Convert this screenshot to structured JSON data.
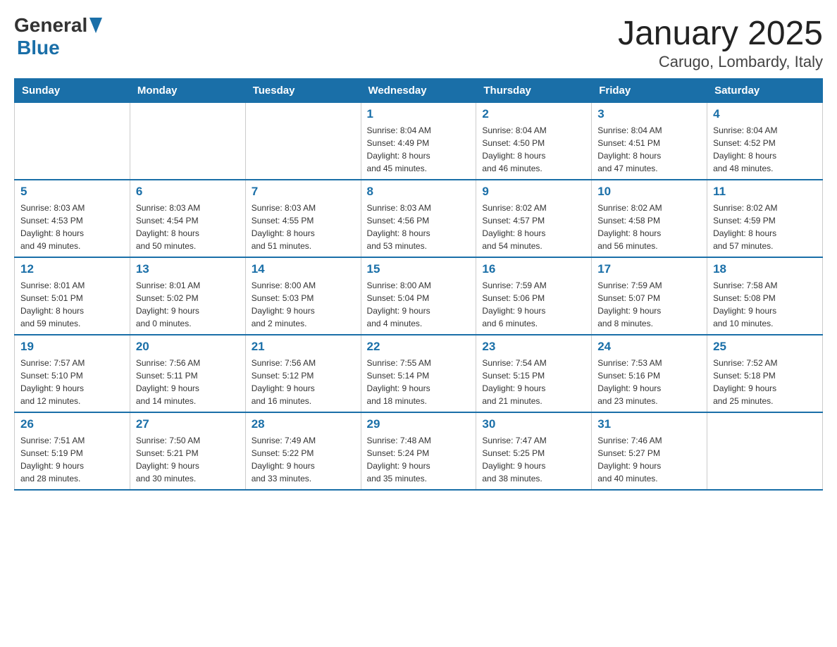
{
  "header": {
    "logo": {
      "general": "General",
      "blue": "Blue",
      "tagline": "GeneralBlue"
    },
    "title": "January 2025",
    "subtitle": "Carugo, Lombardy, Italy"
  },
  "days_of_week": [
    "Sunday",
    "Monday",
    "Tuesday",
    "Wednesday",
    "Thursday",
    "Friday",
    "Saturday"
  ],
  "weeks": [
    [
      {
        "day": "",
        "info": ""
      },
      {
        "day": "",
        "info": ""
      },
      {
        "day": "",
        "info": ""
      },
      {
        "day": "1",
        "info": "Sunrise: 8:04 AM\nSunset: 4:49 PM\nDaylight: 8 hours\nand 45 minutes."
      },
      {
        "day": "2",
        "info": "Sunrise: 8:04 AM\nSunset: 4:50 PM\nDaylight: 8 hours\nand 46 minutes."
      },
      {
        "day": "3",
        "info": "Sunrise: 8:04 AM\nSunset: 4:51 PM\nDaylight: 8 hours\nand 47 minutes."
      },
      {
        "day": "4",
        "info": "Sunrise: 8:04 AM\nSunset: 4:52 PM\nDaylight: 8 hours\nand 48 minutes."
      }
    ],
    [
      {
        "day": "5",
        "info": "Sunrise: 8:03 AM\nSunset: 4:53 PM\nDaylight: 8 hours\nand 49 minutes."
      },
      {
        "day": "6",
        "info": "Sunrise: 8:03 AM\nSunset: 4:54 PM\nDaylight: 8 hours\nand 50 minutes."
      },
      {
        "day": "7",
        "info": "Sunrise: 8:03 AM\nSunset: 4:55 PM\nDaylight: 8 hours\nand 51 minutes."
      },
      {
        "day": "8",
        "info": "Sunrise: 8:03 AM\nSunset: 4:56 PM\nDaylight: 8 hours\nand 53 minutes."
      },
      {
        "day": "9",
        "info": "Sunrise: 8:02 AM\nSunset: 4:57 PM\nDaylight: 8 hours\nand 54 minutes."
      },
      {
        "day": "10",
        "info": "Sunrise: 8:02 AM\nSunset: 4:58 PM\nDaylight: 8 hours\nand 56 minutes."
      },
      {
        "day": "11",
        "info": "Sunrise: 8:02 AM\nSunset: 4:59 PM\nDaylight: 8 hours\nand 57 minutes."
      }
    ],
    [
      {
        "day": "12",
        "info": "Sunrise: 8:01 AM\nSunset: 5:01 PM\nDaylight: 8 hours\nand 59 minutes."
      },
      {
        "day": "13",
        "info": "Sunrise: 8:01 AM\nSunset: 5:02 PM\nDaylight: 9 hours\nand 0 minutes."
      },
      {
        "day": "14",
        "info": "Sunrise: 8:00 AM\nSunset: 5:03 PM\nDaylight: 9 hours\nand 2 minutes."
      },
      {
        "day": "15",
        "info": "Sunrise: 8:00 AM\nSunset: 5:04 PM\nDaylight: 9 hours\nand 4 minutes."
      },
      {
        "day": "16",
        "info": "Sunrise: 7:59 AM\nSunset: 5:06 PM\nDaylight: 9 hours\nand 6 minutes."
      },
      {
        "day": "17",
        "info": "Sunrise: 7:59 AM\nSunset: 5:07 PM\nDaylight: 9 hours\nand 8 minutes."
      },
      {
        "day": "18",
        "info": "Sunrise: 7:58 AM\nSunset: 5:08 PM\nDaylight: 9 hours\nand 10 minutes."
      }
    ],
    [
      {
        "day": "19",
        "info": "Sunrise: 7:57 AM\nSunset: 5:10 PM\nDaylight: 9 hours\nand 12 minutes."
      },
      {
        "day": "20",
        "info": "Sunrise: 7:56 AM\nSunset: 5:11 PM\nDaylight: 9 hours\nand 14 minutes."
      },
      {
        "day": "21",
        "info": "Sunrise: 7:56 AM\nSunset: 5:12 PM\nDaylight: 9 hours\nand 16 minutes."
      },
      {
        "day": "22",
        "info": "Sunrise: 7:55 AM\nSunset: 5:14 PM\nDaylight: 9 hours\nand 18 minutes."
      },
      {
        "day": "23",
        "info": "Sunrise: 7:54 AM\nSunset: 5:15 PM\nDaylight: 9 hours\nand 21 minutes."
      },
      {
        "day": "24",
        "info": "Sunrise: 7:53 AM\nSunset: 5:16 PM\nDaylight: 9 hours\nand 23 minutes."
      },
      {
        "day": "25",
        "info": "Sunrise: 7:52 AM\nSunset: 5:18 PM\nDaylight: 9 hours\nand 25 minutes."
      }
    ],
    [
      {
        "day": "26",
        "info": "Sunrise: 7:51 AM\nSunset: 5:19 PM\nDaylight: 9 hours\nand 28 minutes."
      },
      {
        "day": "27",
        "info": "Sunrise: 7:50 AM\nSunset: 5:21 PM\nDaylight: 9 hours\nand 30 minutes."
      },
      {
        "day": "28",
        "info": "Sunrise: 7:49 AM\nSunset: 5:22 PM\nDaylight: 9 hours\nand 33 minutes."
      },
      {
        "day": "29",
        "info": "Sunrise: 7:48 AM\nSunset: 5:24 PM\nDaylight: 9 hours\nand 35 minutes."
      },
      {
        "day": "30",
        "info": "Sunrise: 7:47 AM\nSunset: 5:25 PM\nDaylight: 9 hours\nand 38 minutes."
      },
      {
        "day": "31",
        "info": "Sunrise: 7:46 AM\nSunset: 5:27 PM\nDaylight: 9 hours\nand 40 minutes."
      },
      {
        "day": "",
        "info": ""
      }
    ]
  ]
}
